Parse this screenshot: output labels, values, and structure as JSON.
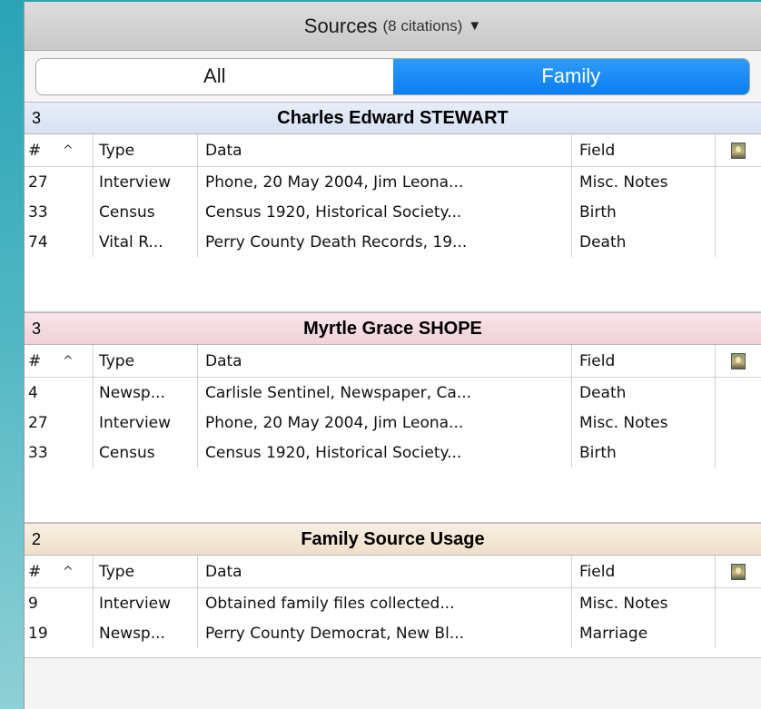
{
  "header": {
    "title": "Sources",
    "count": "(8 citations)",
    "caret": "▼"
  },
  "segments": {
    "all": "All",
    "family": "Family",
    "active": "family"
  },
  "columns": {
    "num": "#",
    "sort": "^",
    "type": "Type",
    "data": "Data",
    "field": "Field"
  },
  "groups": [
    {
      "count": "3",
      "name": "Charles Edward STEWART",
      "color": "#d6e1f2",
      "rows": [
        {
          "num": "27",
          "type": "Interview",
          "data": "Phone, 20 May 2004, Jim Leona...",
          "field": "Misc. Notes"
        },
        {
          "num": "33",
          "type": "Census",
          "data": "Census 1920, Historical Society...",
          "field": "Birth"
        },
        {
          "num": "74",
          "type": "Vital R...",
          "data": "Perry County Death Records, 19...",
          "field": "Death"
        }
      ]
    },
    {
      "count": "3",
      "name": "Myrtle Grace SHOPE",
      "color": "#f0d1d8",
      "rows": [
        {
          "num": "4",
          "type": "Newsp...",
          "data": "Carlisle Sentinel, Newspaper, Ca...",
          "field": "Death"
        },
        {
          "num": "27",
          "type": "Interview",
          "data": "Phone, 20 May 2004, Jim Leona...",
          "field": "Misc. Notes"
        },
        {
          "num": "33",
          "type": "Census",
          "data": "Census 1920, Historical Society...",
          "field": "Birth"
        }
      ]
    },
    {
      "count": "2",
      "name": "Family Source Usage",
      "color": "#eedfc9",
      "rows": [
        {
          "num": "9",
          "type": "Interview",
          "data": "Obtained family files collected...",
          "field": "Misc. Notes"
        },
        {
          "num": "19",
          "type": "Newsp...",
          "data": "Perry County Democrat, New Bl...",
          "field": "Marriage"
        }
      ]
    }
  ]
}
